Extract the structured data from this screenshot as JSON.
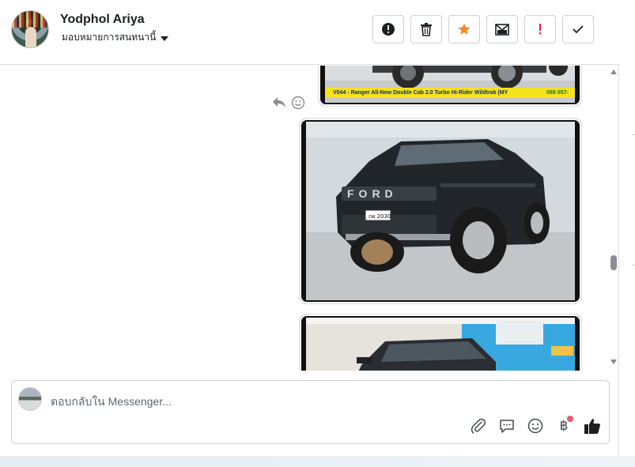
{
  "header": {
    "user_name": "Yodphol Ariya",
    "assign_label": "มอบหมายการสนทนานี้",
    "actions": [
      {
        "name": "mark-spam-button",
        "icon": "alert-circle-icon"
      },
      {
        "name": "delete-button",
        "icon": "trash-icon"
      },
      {
        "name": "star-button",
        "icon": "star-icon"
      },
      {
        "name": "mark-unread-button",
        "icon": "envelope-icon"
      },
      {
        "name": "follow-up-button",
        "icon": "exclamation-icon"
      },
      {
        "name": "done-button",
        "icon": "checkmark-icon"
      }
    ]
  },
  "conversation": {
    "banner_text": "V044 - Ranger All-New Double Cab 2.0 Turbo Hi-Rider Wildtrak (MY",
    "banner_phone": "088-557-",
    "plate_text": "กผ 2030",
    "grille_text": "FORD"
  },
  "composer": {
    "placeholder": "ตอบกลับใน Messenger...",
    "tools": [
      "paperclip-icon",
      "saved-reply-icon",
      "emoji-icon",
      "payment-icon",
      "thumbs-up-icon"
    ],
    "payment_symbol": "฿"
  },
  "colors": {
    "star": "#f08a24",
    "follow_up": "#e41e3f",
    "banner": "#f4e21b",
    "notification_dot": "#e85d75"
  }
}
